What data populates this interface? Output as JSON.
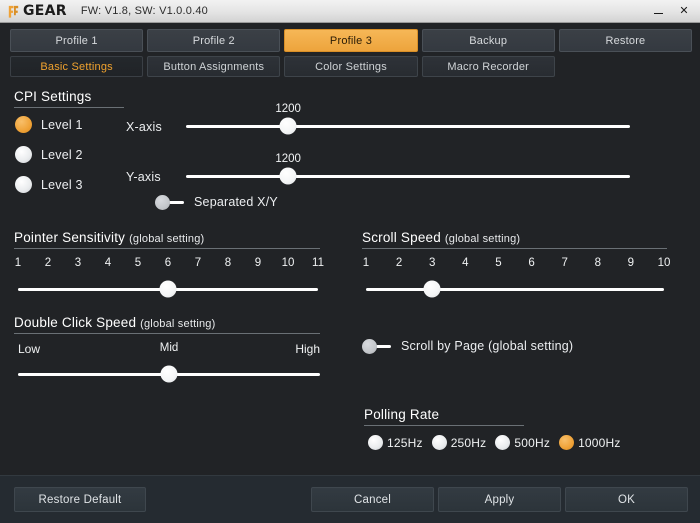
{
  "titlebar": {
    "brand": "GEAR",
    "firmware": "FW: V1.8, SW: V1.0.0.40",
    "minimize_label": "",
    "close_label": "✕"
  },
  "tabs": {
    "primary": [
      {
        "label": "Profile 1",
        "active": false
      },
      {
        "label": "Profile 2",
        "active": false
      },
      {
        "label": "Profile 3",
        "active": true
      },
      {
        "label": "Backup",
        "active": false
      },
      {
        "label": "Restore",
        "active": false
      }
    ],
    "secondary": [
      {
        "label": "Basic Settings",
        "active": true
      },
      {
        "label": "Button Assignments",
        "active": false
      },
      {
        "label": "Color Settings",
        "active": false
      },
      {
        "label": "Macro Recorder",
        "active": false
      }
    ]
  },
  "cpi": {
    "title": "CPI Settings",
    "levels": [
      {
        "label": "Level 1",
        "selected": true
      },
      {
        "label": "Level 2",
        "selected": false
      },
      {
        "label": "Level 3",
        "selected": false
      }
    ],
    "x_axis": {
      "label": "X-axis",
      "value": "1200",
      "percent": 23
    },
    "y_axis": {
      "label": "Y-axis",
      "value": "1200",
      "percent": 23
    },
    "separated": {
      "label": "Separated X/Y",
      "on": false
    }
  },
  "pointer_sensitivity": {
    "title": "Pointer Sensitivity",
    "subtitle": "(global setting)",
    "ticks": [
      "1",
      "2",
      "3",
      "4",
      "5",
      "6",
      "7",
      "8",
      "9",
      "10",
      "11"
    ],
    "value": 6
  },
  "scroll_speed": {
    "title": "Scroll Speed",
    "subtitle": "(global setting)",
    "ticks": [
      "1",
      "2",
      "3",
      "4",
      "5",
      "6",
      "7",
      "8",
      "9",
      "10"
    ],
    "value": 3
  },
  "double_click_speed": {
    "title": "Double Click Speed",
    "subtitle": "(global setting)",
    "low_label": "Low",
    "mid_label": "Mid",
    "high_label": "High",
    "percent": 50
  },
  "scroll_by_page": {
    "label": "Scroll by Page (global setting)",
    "on": false
  },
  "polling_rate": {
    "title": "Polling Rate",
    "options": [
      {
        "label": "125Hz",
        "selected": false
      },
      {
        "label": "250Hz",
        "selected": false
      },
      {
        "label": "500Hz",
        "selected": false
      },
      {
        "label": "1000Hz",
        "selected": true
      }
    ]
  },
  "footer": {
    "restore_default": "Restore Default",
    "cancel": "Cancel",
    "apply": "Apply",
    "ok": "OK"
  },
  "colors": {
    "accent": "#efa237",
    "background": "#212326",
    "footer_bg": "#252b31"
  }
}
